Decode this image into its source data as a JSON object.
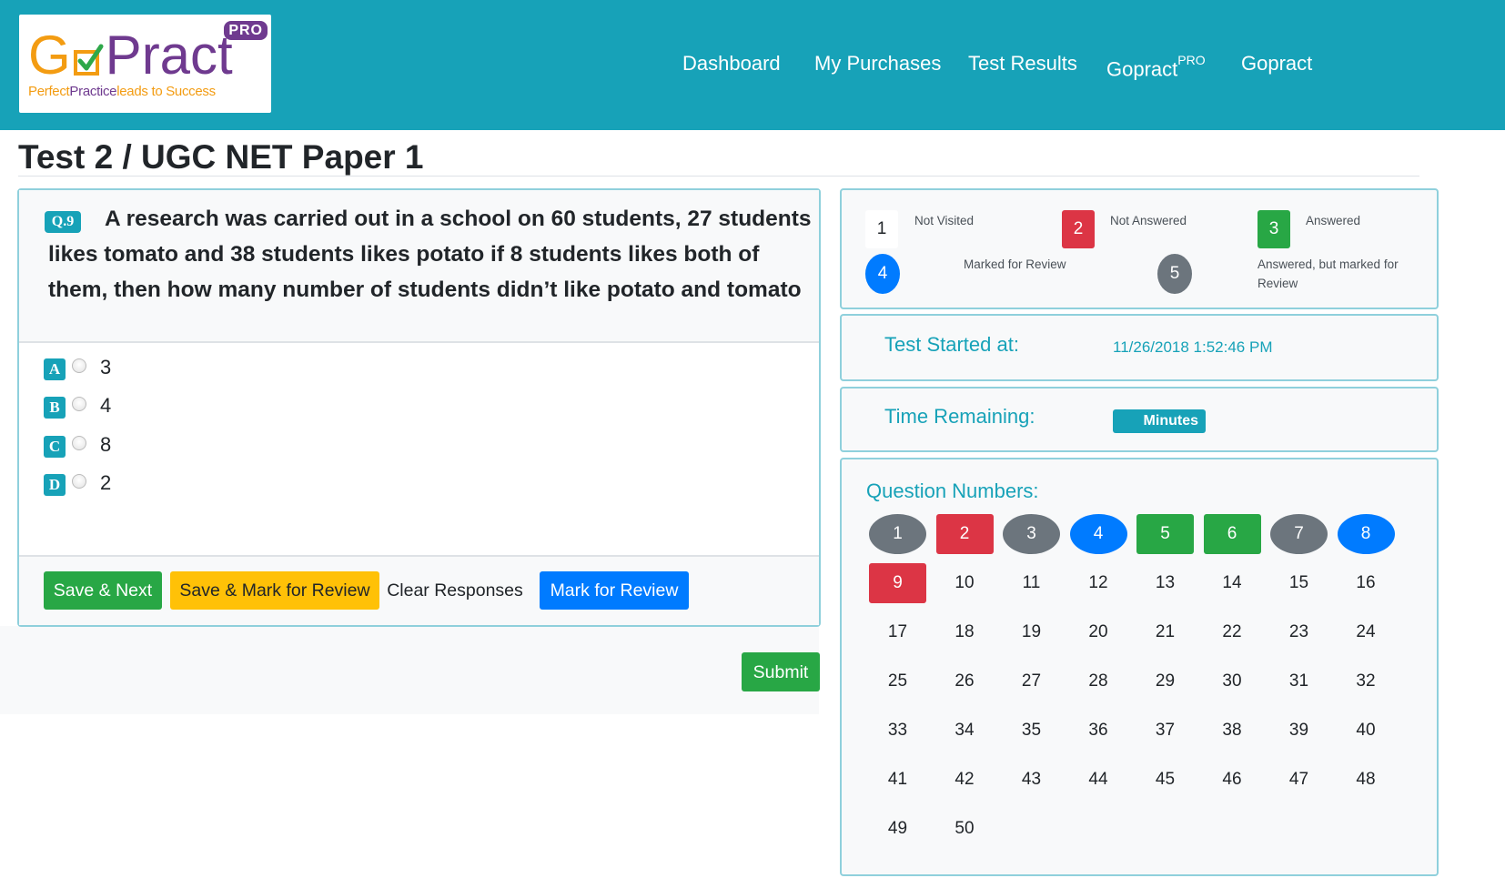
{
  "brand": {
    "logo_g": "G",
    "logo_pract": "Pract",
    "logo_pro": "PRO",
    "tagline_perfect": "Perfect",
    "tagline_practice": "Practice",
    "tagline_rest": "leads to Success"
  },
  "nav": {
    "items": [
      {
        "label": "Dashboard"
      },
      {
        "label": "My Purchases"
      },
      {
        "label": "Test Results"
      },
      {
        "label": "Gopract",
        "sup": "PRO"
      },
      {
        "label": "Gopract"
      }
    ]
  },
  "page": {
    "title": "Test 2 / UGC NET Paper 1"
  },
  "question": {
    "badge": "Q.9",
    "text": "A research was carried out in a school on 60 students, 27 students likes tomato and 38 students likes potato if 8 students likes both of them, then how many number of students didn’t like potato and tomato",
    "options": [
      {
        "key": "A",
        "text": "3"
      },
      {
        "key": "B",
        "text": "4"
      },
      {
        "key": "C",
        "text": "8"
      },
      {
        "key": "D",
        "text": "2"
      }
    ]
  },
  "actions": {
    "save_next": "Save & Next",
    "save_mark_review": "Save & Mark for Review",
    "clear_responses": "Clear Responses",
    "mark_review": "Mark for Review",
    "submit": "Submit"
  },
  "legend": {
    "not_visited": {
      "num": "1",
      "label": "Not Visited"
    },
    "not_answered": {
      "num": "2",
      "label": "Not Answered"
    },
    "answered": {
      "num": "3",
      "label": "Answered"
    },
    "marked_review": {
      "num": "4",
      "label": "Marked for Review"
    },
    "answered_marked": {
      "num": "5",
      "label": "Answered, but marked for Review"
    }
  },
  "test_started": {
    "label": "Test Started at:",
    "value": "11/26/2018 1:52:46 PM"
  },
  "time_remaining": {
    "label": "Time Remaining:",
    "badge": "Minutes"
  },
  "question_numbers": {
    "title": "Question Numbers:",
    "items": [
      {
        "n": "1",
        "status": "visited"
      },
      {
        "n": "2",
        "status": "not-answered"
      },
      {
        "n": "3",
        "status": "visited"
      },
      {
        "n": "4",
        "status": "marked"
      },
      {
        "n": "5",
        "status": "answered"
      },
      {
        "n": "6",
        "status": "answered"
      },
      {
        "n": "7",
        "status": "visited"
      },
      {
        "n": "8",
        "status": "marked"
      },
      {
        "n": "9",
        "status": "not-answered"
      },
      {
        "n": "10",
        "status": "not-visited"
      },
      {
        "n": "11",
        "status": "not-visited"
      },
      {
        "n": "12",
        "status": "not-visited"
      },
      {
        "n": "13",
        "status": "not-visited"
      },
      {
        "n": "14",
        "status": "not-visited"
      },
      {
        "n": "15",
        "status": "not-visited"
      },
      {
        "n": "16",
        "status": "not-visited"
      },
      {
        "n": "17",
        "status": "not-visited"
      },
      {
        "n": "18",
        "status": "not-visited"
      },
      {
        "n": "19",
        "status": "not-visited"
      },
      {
        "n": "20",
        "status": "not-visited"
      },
      {
        "n": "21",
        "status": "not-visited"
      },
      {
        "n": "22",
        "status": "not-visited"
      },
      {
        "n": "23",
        "status": "not-visited"
      },
      {
        "n": "24",
        "status": "not-visited"
      },
      {
        "n": "25",
        "status": "not-visited"
      },
      {
        "n": "26",
        "status": "not-visited"
      },
      {
        "n": "27",
        "status": "not-visited"
      },
      {
        "n": "28",
        "status": "not-visited"
      },
      {
        "n": "29",
        "status": "not-visited"
      },
      {
        "n": "30",
        "status": "not-visited"
      },
      {
        "n": "31",
        "status": "not-visited"
      },
      {
        "n": "32",
        "status": "not-visited"
      },
      {
        "n": "33",
        "status": "not-visited"
      },
      {
        "n": "34",
        "status": "not-visited"
      },
      {
        "n": "35",
        "status": "not-visited"
      },
      {
        "n": "36",
        "status": "not-visited"
      },
      {
        "n": "37",
        "status": "not-visited"
      },
      {
        "n": "38",
        "status": "not-visited"
      },
      {
        "n": "39",
        "status": "not-visited"
      },
      {
        "n": "40",
        "status": "not-visited"
      },
      {
        "n": "41",
        "status": "not-visited"
      },
      {
        "n": "42",
        "status": "not-visited"
      },
      {
        "n": "43",
        "status": "not-visited"
      },
      {
        "n": "44",
        "status": "not-visited"
      },
      {
        "n": "45",
        "status": "not-visited"
      },
      {
        "n": "46",
        "status": "not-visited"
      },
      {
        "n": "47",
        "status": "not-visited"
      },
      {
        "n": "48",
        "status": "not-visited"
      },
      {
        "n": "49",
        "status": "not-visited"
      },
      {
        "n": "50",
        "status": "not-visited"
      }
    ]
  },
  "colors": {
    "primary_teal": "#17a2b8",
    "answered_green": "#28a745",
    "not_answered_red": "#dc3545",
    "marked_blue": "#007bff",
    "visited_gray": "#6c757d",
    "review_yellow": "#ffc107",
    "logo_orange": "#f39c12",
    "logo_purple": "#6f3a8f"
  }
}
